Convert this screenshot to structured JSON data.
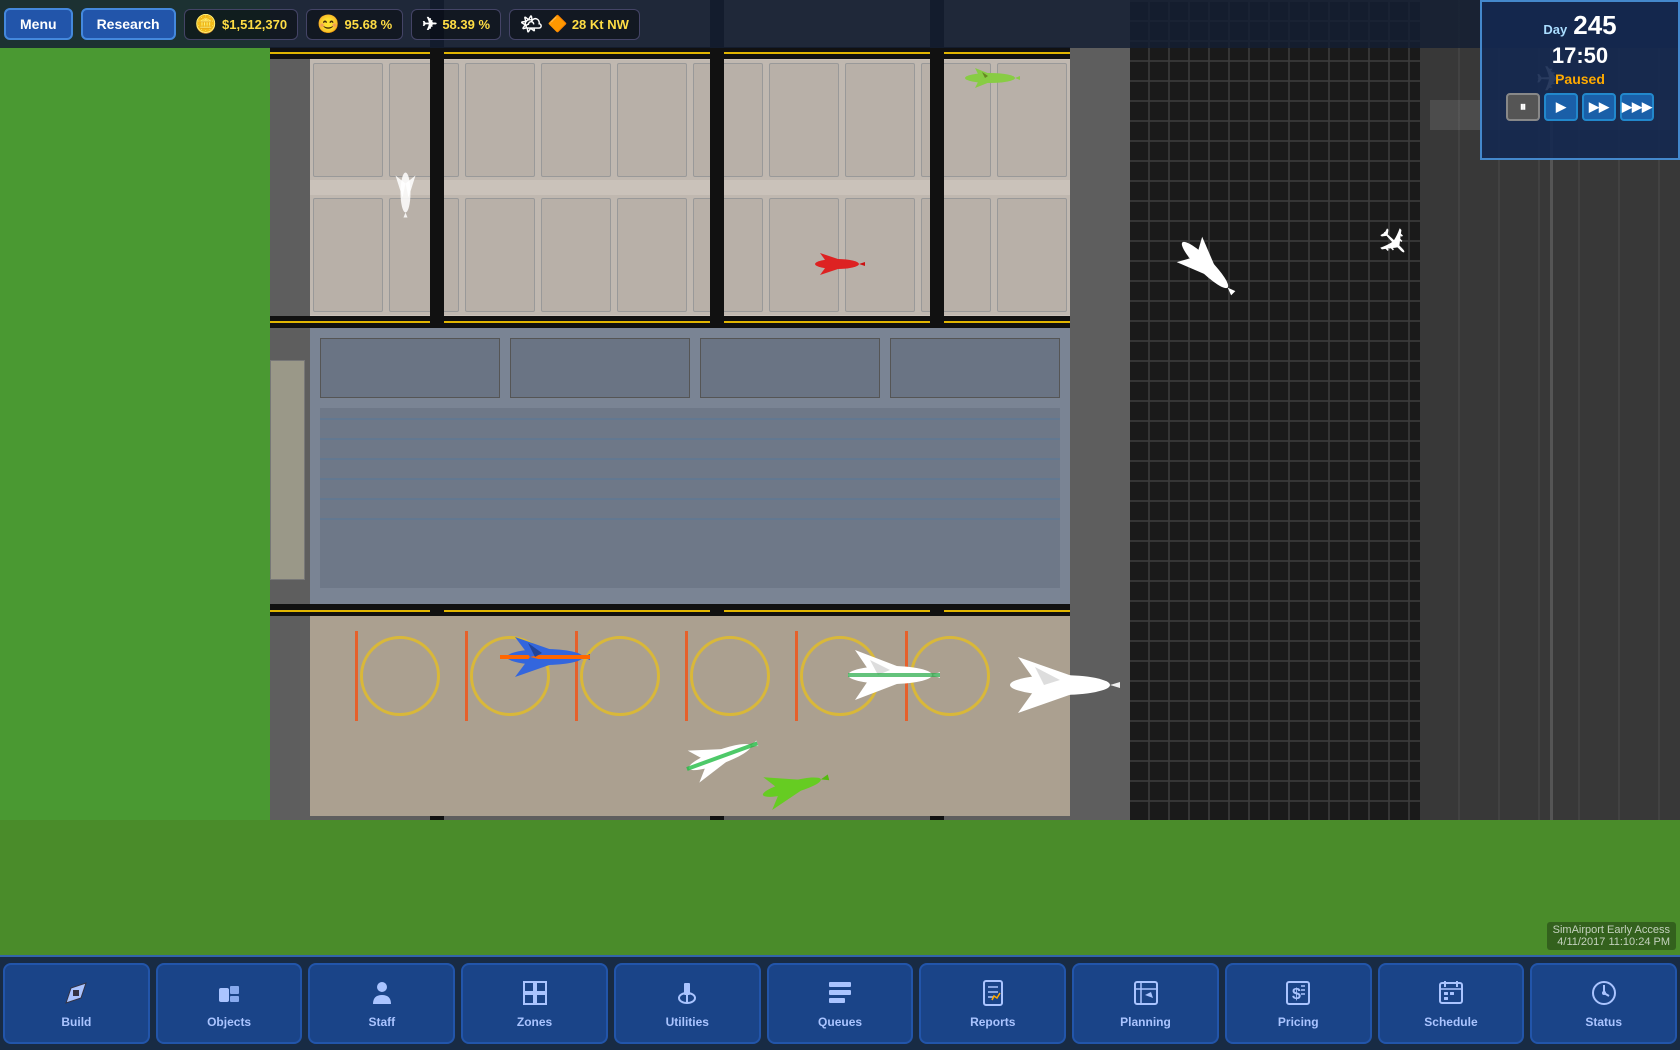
{
  "topbar": {
    "menu_label": "Menu",
    "research_label": "Research",
    "money": "$1,512,370",
    "happiness": "95.68 %",
    "flights": "58.39 %",
    "wind": "28 Kt NW"
  },
  "datetime": {
    "day_label": "Day",
    "day": "245",
    "time": "17:50",
    "status": "Paused"
  },
  "speed_controls": {
    "pause": "⏸",
    "play": "▶",
    "fast": "▶▶",
    "fastest": "▶▶▶"
  },
  "toolbar": {
    "items": [
      {
        "id": "build",
        "label": "Build",
        "icon": "🔧"
      },
      {
        "id": "objects",
        "label": "Objects",
        "icon": "🪑"
      },
      {
        "id": "staff",
        "label": "Staff",
        "icon": "👤"
      },
      {
        "id": "zones",
        "label": "Zones",
        "icon": "◈"
      },
      {
        "id": "utilities",
        "label": "Utilities",
        "icon": "⛽"
      },
      {
        "id": "queues",
        "label": "Queues",
        "icon": "⊞"
      },
      {
        "id": "reports",
        "label": "Reports",
        "icon": "📋"
      },
      {
        "id": "planning",
        "label": "Planning",
        "icon": "✏"
      },
      {
        "id": "pricing",
        "label": "Pricing",
        "icon": "💲"
      },
      {
        "id": "schedule",
        "label": "Schedule",
        "icon": "📅"
      },
      {
        "id": "status",
        "label": "Status",
        "icon": "🕐"
      }
    ]
  },
  "watermark": {
    "line1": "SimAirport Early Access",
    "line2": "4/11/2017 11:10:24 PM"
  }
}
